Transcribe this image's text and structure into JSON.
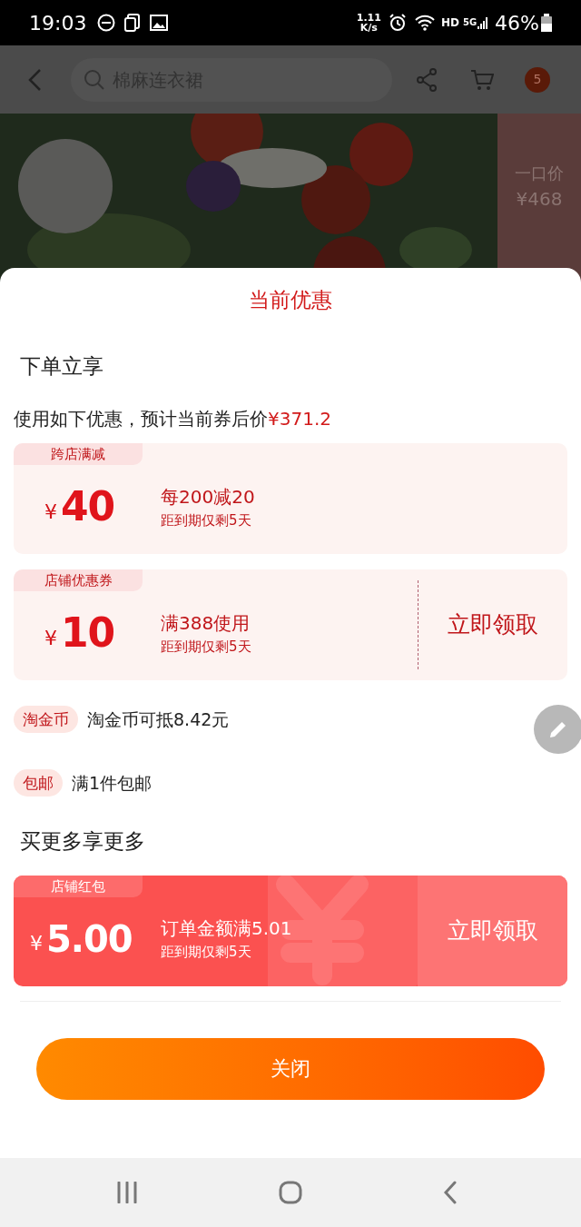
{
  "status_bar": {
    "time": "19:03",
    "speed_value": "1.11",
    "speed_unit": "K/s",
    "network": "HD",
    "generation": "5G",
    "battery": "46%"
  },
  "header": {
    "search_placeholder": "棉麻连衣裙",
    "cart_badge": "5"
  },
  "banner": {
    "kind": "picture",
    "price_label": "一口价",
    "price": "¥468"
  },
  "sheet": {
    "title": "当前优惠",
    "section_1": "下单立享",
    "summary": "使用如下优惠，预计当前券后价",
    "summary_price": "¥371.2",
    "coupons": [
      {
        "kind": "coupon",
        "tag": "跨店满减",
        "currency": "¥",
        "amount": "40",
        "condition": "每200减20",
        "expiry": "距到期仅剩5天"
      },
      {
        "kind": "coupon",
        "tag": "店铺优惠券",
        "currency": "¥",
        "amount": "10",
        "condition": "满388使用",
        "expiry": "距到期仅剩5天",
        "action": "立即领取"
      }
    ],
    "perks": [
      {
        "badge": "淘金币",
        "text": "淘金币可抵8.42元"
      },
      {
        "badge": "包邮",
        "text": "满1件包邮"
      }
    ],
    "section_2": "买更多享更多",
    "more": [
      {
        "kind": "red_packet",
        "tag": "店铺红包",
        "currency": "¥",
        "amount": "5.00",
        "condition": "订单金额满5.01",
        "expiry": "距到期仅剩5天",
        "action": "立即领取"
      }
    ],
    "close_button": "关闭"
  }
}
